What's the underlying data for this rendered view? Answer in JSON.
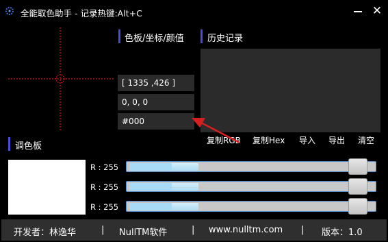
{
  "window": {
    "title": "全能取色助手 - 记录热键:Alt+C",
    "close_glyph": "✕"
  },
  "panels": {
    "color_info_title": "色板/坐标/颜值",
    "history_title": "历史记录",
    "palette_title": "调色板"
  },
  "fields": {
    "coordinates": "[ 1335 ,426 ]",
    "rgb": "0, 0, 0",
    "hex": "#000"
  },
  "history": {
    "buttons": [
      "复制RGB",
      "复制Hex",
      "导入",
      "导出",
      "清空"
    ]
  },
  "palette": {
    "swatch_color": "#ffffff",
    "channels": [
      {
        "label": "R : 255",
        "value": 255
      },
      {
        "label": "R : 255",
        "value": 255
      },
      {
        "label": "R : 255",
        "value": 255
      }
    ]
  },
  "status": {
    "developer": "开发者：林逸华",
    "company": "NullTM软件",
    "website": "www.nulltm.com",
    "version": "版本：1.0",
    "separator": "|"
  },
  "colors": {
    "accent": "#4b4dd6",
    "crosshair": "#ff2020",
    "arrow": "#d42020"
  }
}
